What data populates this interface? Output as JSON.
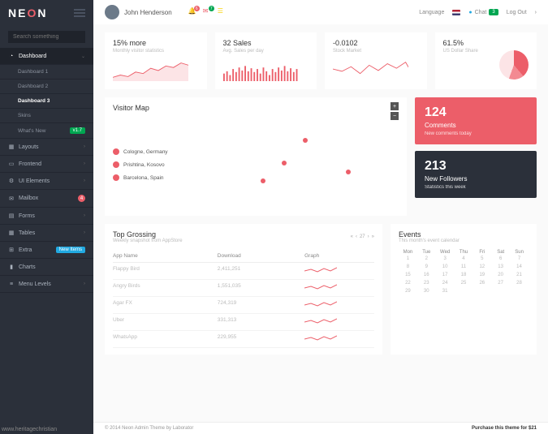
{
  "logo": {
    "text_pre": "NE",
    "text_post": "N"
  },
  "search": {
    "placeholder": "Search something"
  },
  "nav": {
    "dashboard": {
      "label": "Dashboard",
      "sub1": "Dashboard 1",
      "sub2": "Dashboard 2",
      "sub3": "Dashboard 3",
      "skins": "Skins",
      "whatsnew": "What's New",
      "whatsnew_badge": "v1.7"
    },
    "layouts": "Layouts",
    "frontend": "Frontend",
    "ui": "UI Elements",
    "mailbox": {
      "label": "Mailbox",
      "badge": "4"
    },
    "forms": "Forms",
    "tables": "Tables",
    "extra": {
      "label": "Extra",
      "badge": "New Items"
    },
    "charts": "Charts",
    "menulevels": "Menu Levels"
  },
  "topbar": {
    "user": "John Henderson",
    "icon1_badge": "6",
    "icon2_badge": "7",
    "lang": "Language",
    "chat": "Chat",
    "chat_badge": "3",
    "logout": "Log Out"
  },
  "stats": [
    {
      "title": "15% more",
      "sub": "Monthly visitor statistics"
    },
    {
      "title": "32 Sales",
      "sub": "Avg. Sales per day"
    },
    {
      "title": "-0.0102",
      "sub": "Stock Market"
    },
    {
      "title": "61.5%",
      "sub": "US Dollar Share"
    }
  ],
  "visitor_map": {
    "title": "Visitor Map",
    "locations": [
      "Cologne, Germany",
      "Prishtina, Kosovo",
      "Barcelona, Spain"
    ]
  },
  "comments_card": {
    "value": "124",
    "label": "Comments",
    "sub": "New comments today"
  },
  "followers_card": {
    "value": "213",
    "label": "New Followers",
    "sub": "Statistics this week"
  },
  "top_grossing": {
    "title": "Top Grossing",
    "sub": "Weekly snapshot from AppStore",
    "pager": "27",
    "cols": {
      "c1": "App Name",
      "c2": "Download",
      "c3": "Graph"
    },
    "rows": [
      {
        "name": "Flappy Bird",
        "dl": "2,411,251"
      },
      {
        "name": "Angry Birds",
        "dl": "1,551,035"
      },
      {
        "name": "Agar FX",
        "dl": "724,319"
      },
      {
        "name": "Uber",
        "dl": "331,313"
      },
      {
        "name": "WhatsApp",
        "dl": "229,955"
      }
    ]
  },
  "events": {
    "title": "Events",
    "sub": "This month's event calendar",
    "days": [
      "Mon",
      "Tue",
      "Wed",
      "Thu",
      "Fri",
      "Sat",
      "Sun"
    ]
  },
  "footer": {
    "left": "© 2014 Neon Admin Theme by Laborator",
    "right": "Purchase this theme for $21"
  },
  "watermark": "www.heritagechristian",
  "chart_data": [
    {
      "type": "area",
      "title": "15% more",
      "values": [
        10,
        14,
        11,
        17,
        15,
        22,
        19,
        25,
        23,
        29
      ]
    },
    {
      "type": "bar",
      "title": "32 Sales",
      "values": [
        8,
        10,
        6,
        12,
        9,
        14,
        11,
        15,
        10,
        13,
        9,
        12,
        8,
        14,
        10,
        6,
        12,
        9,
        14,
        11,
        15,
        10,
        13,
        9,
        12
      ]
    },
    {
      "type": "line",
      "title": "-0.0102",
      "values": [
        20,
        18,
        22,
        15,
        24,
        17,
        26,
        20,
        28,
        22
      ]
    },
    {
      "type": "pie",
      "title": "US Dollar Share",
      "values": [
        61.5,
        16,
        22.5
      ]
    }
  ]
}
